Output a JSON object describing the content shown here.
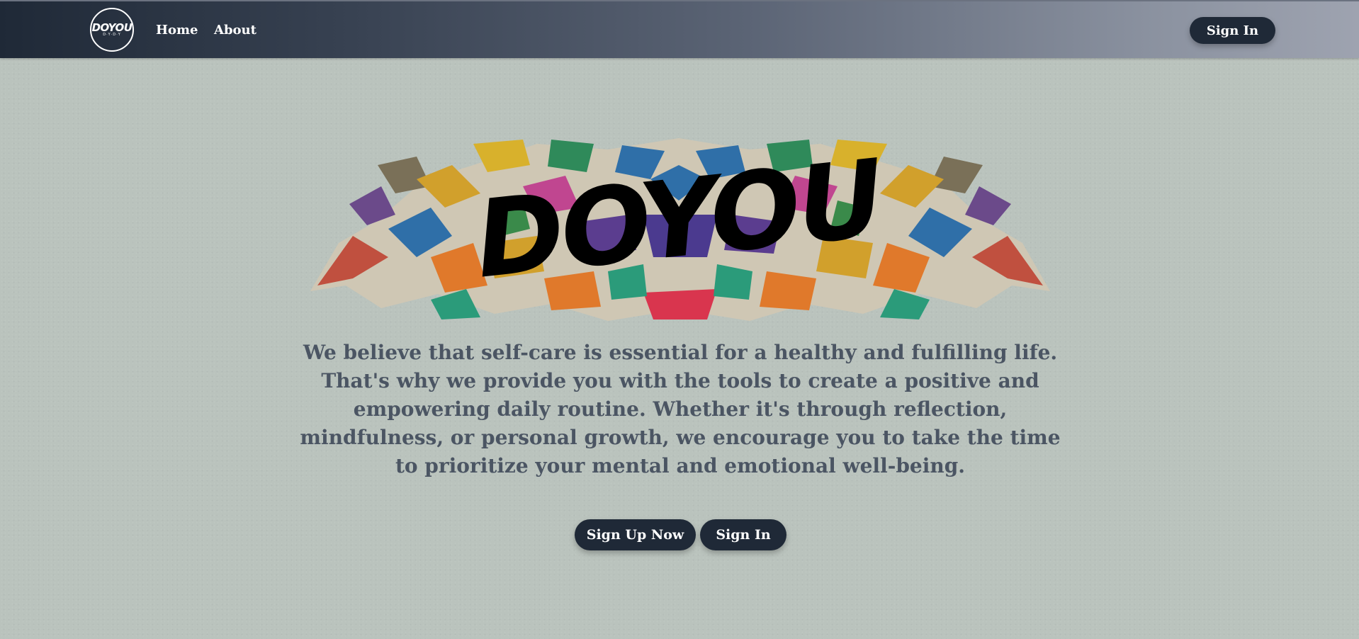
{
  "nav": {
    "logo_text": "DOYOU",
    "logo_subtext": "D·Y·D·Y",
    "links": [
      {
        "label": "Home"
      },
      {
        "label": "About"
      }
    ],
    "signin_label": "Sign In",
    "colors": {
      "gradient_start": "#1f2937",
      "gradient_end": "#9ea3b0"
    }
  },
  "hero": {
    "banner_text": "DOYOU",
    "tagline": "We believe that self-care is essential for a healthy and fulfilling life. That's why we provide you with the tools to create a positive and empowering daily routine. Whether it's through reflection, mindfulness, or personal growth, we encourage you to take the time to prioritize your mental and emotional well-being.",
    "cta_primary": "Sign Up Now",
    "cta_secondary": "Sign In"
  },
  "theme": {
    "background": "#bac3bd",
    "button_bg": "#1f2937",
    "button_text": "#ffffff",
    "tagline_color": "#4b5563"
  }
}
